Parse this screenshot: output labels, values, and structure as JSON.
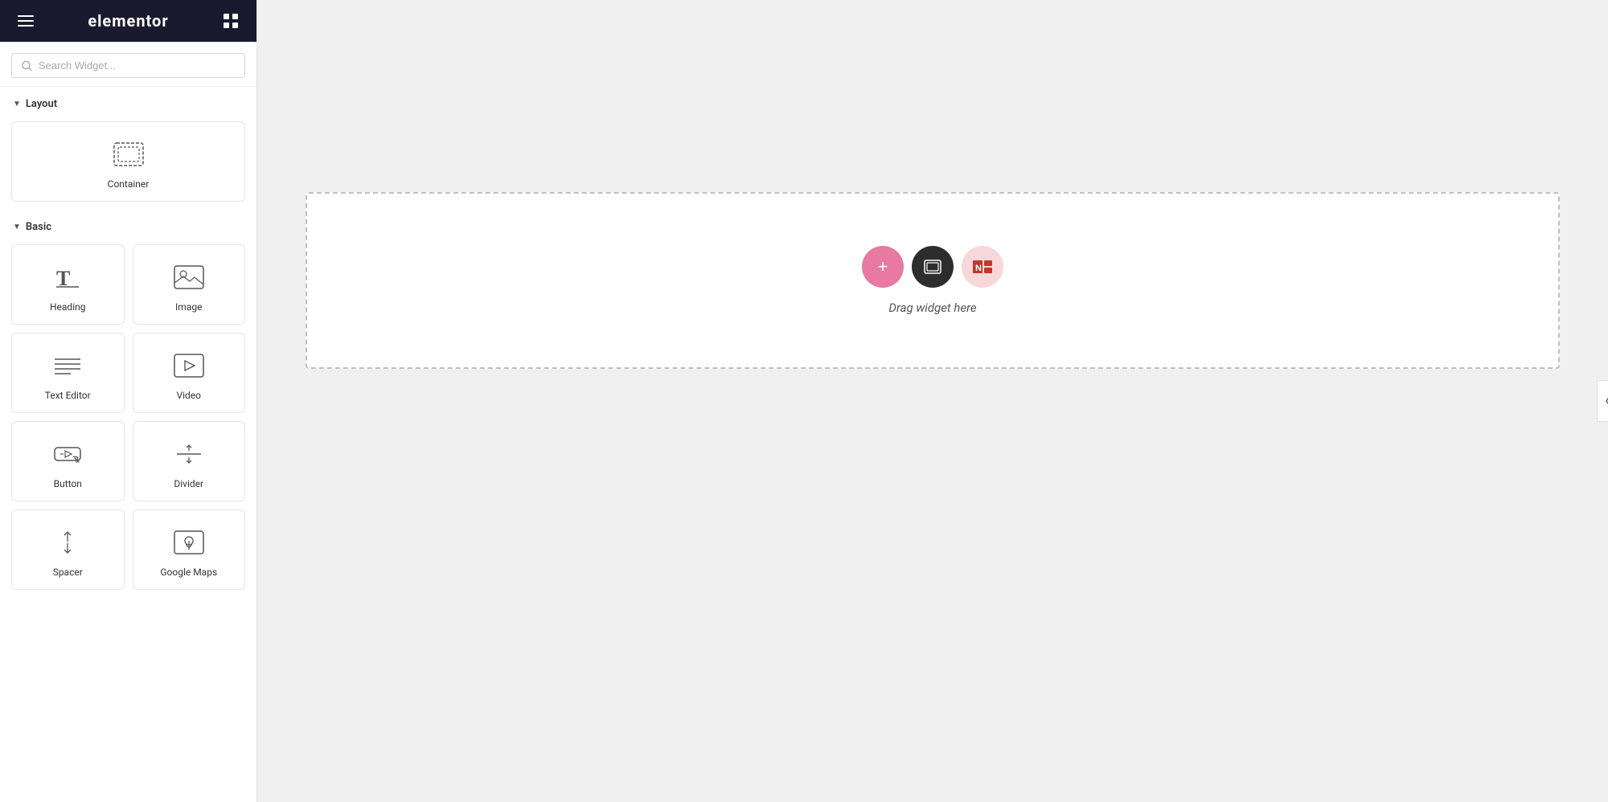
{
  "header": {
    "logo": "elementor",
    "hamburger_label": "menu",
    "grid_label": "apps-grid"
  },
  "search": {
    "placeholder": "Search Widget..."
  },
  "sections": {
    "layout": {
      "label": "Layout",
      "widgets": [
        {
          "id": "container",
          "label": "Container",
          "icon": "container-icon"
        }
      ]
    },
    "basic": {
      "label": "Basic",
      "widgets": [
        {
          "id": "heading",
          "label": "Heading",
          "icon": "heading-icon"
        },
        {
          "id": "image",
          "label": "Image",
          "icon": "image-icon"
        },
        {
          "id": "text-editor",
          "label": "Text Editor",
          "icon": "text-editor-icon"
        },
        {
          "id": "video",
          "label": "Video",
          "icon": "video-icon"
        },
        {
          "id": "button",
          "label": "Button",
          "icon": "button-icon"
        },
        {
          "id": "divider",
          "label": "Divider",
          "icon": "divider-icon"
        },
        {
          "id": "spacer",
          "label": "Spacer",
          "icon": "spacer-icon"
        },
        {
          "id": "google-maps",
          "label": "Google Maps",
          "icon": "google-maps-icon"
        }
      ]
    }
  },
  "canvas": {
    "drag_text": "Drag widget here",
    "add_label": "+",
    "container_label": "container",
    "news_label": "N"
  }
}
